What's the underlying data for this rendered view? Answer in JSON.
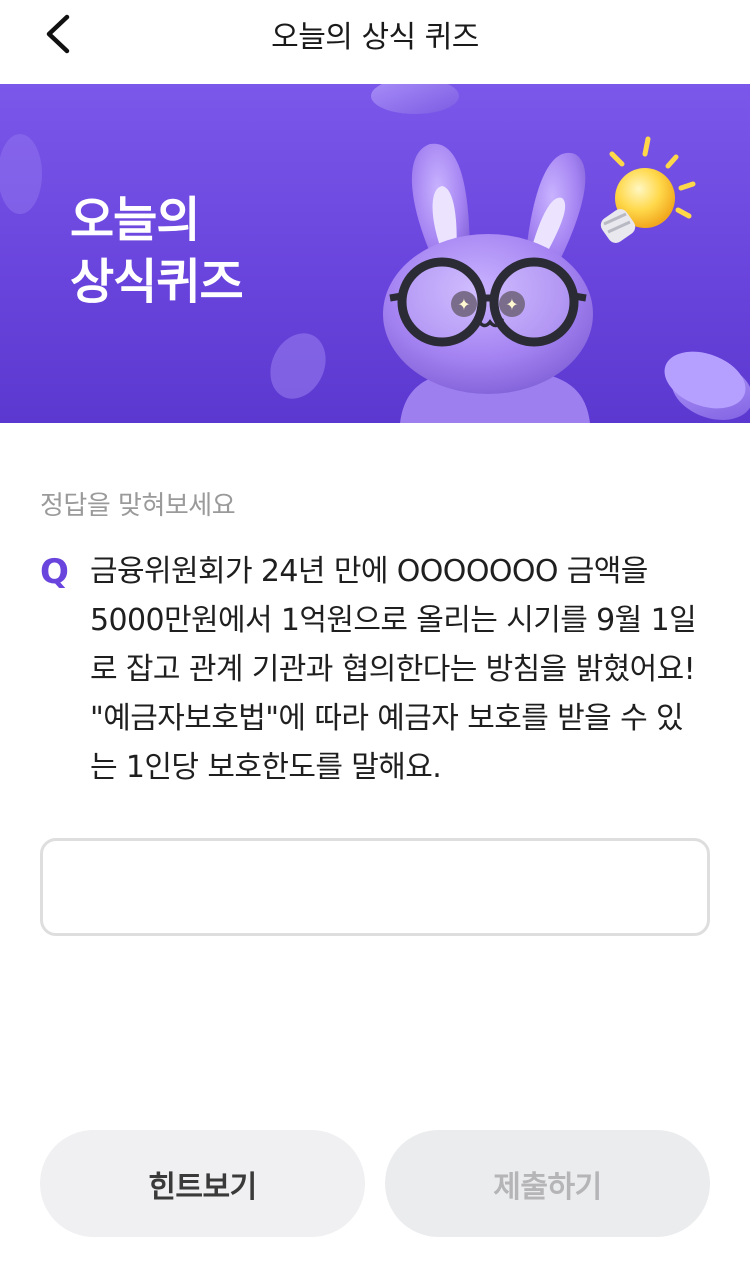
{
  "header": {
    "title": "오늘의 상식 퀴즈",
    "back_icon": "chevron-left-icon"
  },
  "banner": {
    "title_line1": "오늘의",
    "title_line2": "상식퀴즈",
    "background_color": "#6a45dd",
    "illustration": "rabbit-with-glasses",
    "decor_icon": "lightbulb-icon"
  },
  "quiz": {
    "instruction": "정답을 맞혀보세요",
    "q_marker": "Q",
    "question_lines": [
      "금융위원회가 24년 만에 OOOOOOO 금액을",
      "5000만원에서 1억원으로 올리는 시기를 9월 1일",
      "로 잡고 관계 기관과 협의한다는 방침을 밝혔어요!",
      "\"예금자보호법\"에 따라 예금자 보호를 받을 수 있",
      "는 1인당 보호한도를 말해요."
    ],
    "answer_value": "",
    "answer_placeholder": "",
    "accent_color": "#6a45dd"
  },
  "actions": {
    "hint_label": "힌트보기",
    "submit_label": "제출하기"
  }
}
